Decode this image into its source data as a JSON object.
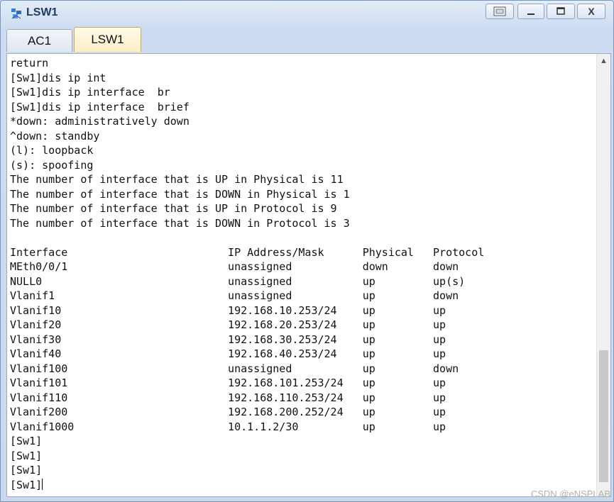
{
  "window": {
    "title": "LSW1",
    "icon": "switch-icon",
    "controls": {
      "restore": "restore-icon",
      "minimize": "minimize-icon",
      "maximize": "maximize-icon",
      "close": "X"
    }
  },
  "tabs": [
    {
      "label": "AC1",
      "active": false
    },
    {
      "label": "LSW1",
      "active": true
    }
  ],
  "terminal": {
    "lines": [
      "return",
      "[Sw1]dis ip int",
      "[Sw1]dis ip interface  br",
      "[Sw1]dis ip interface  brief",
      "*down: administratively down",
      "^down: standby",
      "(l): loopback",
      "(s): spoofing",
      "The number of interface that is UP in Physical is 11",
      "The number of interface that is DOWN in Physical is 1",
      "The number of interface that is UP in Protocol is 9",
      "The number of interface that is DOWN in Protocol is 3",
      "",
      "Interface                         IP Address/Mask      Physical   Protocol",
      "MEth0/0/1                         unassigned           down       down",
      "NULL0                             unassigned           up         up(s)",
      "Vlanif1                           unassigned           up         down",
      "Vlanif10                          192.168.10.253/24    up         up",
      "Vlanif20                          192.168.20.253/24    up         up",
      "Vlanif30                          192.168.30.253/24    up         up",
      "Vlanif40                          192.168.40.253/24    up         up",
      "Vlanif100                         unassigned           up         down",
      "Vlanif101                         192.168.101.253/24   up         up",
      "Vlanif110                         192.168.110.253/24   up         up",
      "Vlanif200                         192.168.200.252/24   up         up",
      "Vlanif1000                        10.1.1.2/30          up         up",
      "[Sw1]",
      "[Sw1]",
      "[Sw1]",
      "[Sw1]"
    ]
  },
  "watermark": "CSDN @eNSPLAB"
}
